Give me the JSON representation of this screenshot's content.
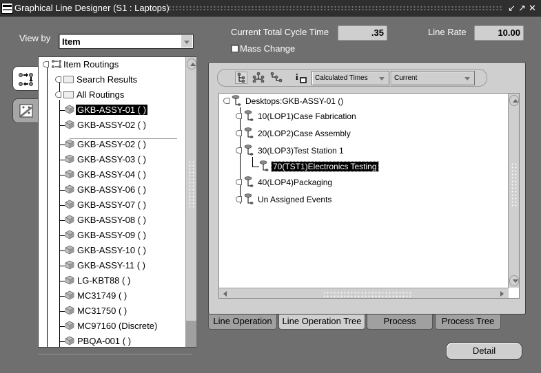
{
  "window": {
    "title": "Graphical Line Designer (S1 : Laptops)",
    "controls": [
      "minimize",
      "maximize",
      "close"
    ]
  },
  "header": {
    "view_by_label": "View by",
    "view_by_value": "Item",
    "cycle_time_label": "Current Total Cycle Time",
    "cycle_time_value": ".35",
    "line_rate_label": "Line Rate",
    "line_rate_value": "10.00",
    "mass_change_label": "Mass Change",
    "mass_change_checked": false
  },
  "left_tabs": [
    {
      "name": "routing-flow",
      "active": true
    },
    {
      "name": "graphical-view",
      "active": false
    }
  ],
  "item_tree": {
    "root": "Item Routings",
    "folders": [
      "Search Results",
      "All Routings"
    ],
    "items": [
      {
        "label": "GKB-ASSY-01 ( )",
        "selected": true
      },
      {
        "label": "GKB-ASSY-02 ( )",
        "selected": false
      },
      {
        "label": "GKB-ASSY-02 ( )",
        "selected": false
      },
      {
        "label": "GKB-ASSY-03 ( )",
        "selected": false
      },
      {
        "label": "GKB-ASSY-04 ( )",
        "selected": false
      },
      {
        "label": "GKB-ASSY-06 ( )",
        "selected": false
      },
      {
        "label": "GKB-ASSY-07 ( )",
        "selected": false
      },
      {
        "label": "GKB-ASSY-08 ( )",
        "selected": false
      },
      {
        "label": "GKB-ASSY-09 ( )",
        "selected": false
      },
      {
        "label": "GKB-ASSY-10 ( )",
        "selected": false
      },
      {
        "label": "GKB-ASSY-11 ( )",
        "selected": false
      },
      {
        "label": "LG-KBT88 ( )",
        "selected": false
      },
      {
        "label": "MC31749 ( )",
        "selected": false
      },
      {
        "label": "MC31750 ( )",
        "selected": false
      },
      {
        "label": "MC97160 (Discrete)",
        "selected": false
      },
      {
        "label": "PBQA-001 ( )",
        "selected": false
      }
    ]
  },
  "toolbar": {
    "times_select": "Calculated Times",
    "version_select": "Current"
  },
  "operation_tree": {
    "root": "Desktops:GKB-ASSY-01 ()",
    "nodes": [
      {
        "label": "10(LOP1)Case Fabrication",
        "level": 1,
        "expander": "plus"
      },
      {
        "label": "20(LOP2)Case Assembly",
        "level": 1,
        "expander": "plus"
      },
      {
        "label": "30(LOP3)Test Station 1",
        "level": 1,
        "expander": "minus"
      },
      {
        "label": "70(TST1)Electronics Testing",
        "level": 2,
        "expander": "none",
        "selected": true
      },
      {
        "label": "40(LOP4)Packaging",
        "level": 1,
        "expander": "plus"
      },
      {
        "label": "Un Assigned Events",
        "level": 1,
        "expander": "plus"
      }
    ]
  },
  "bottom_tabs": [
    {
      "label": "Line Operation",
      "active": false
    },
    {
      "label": "Line Operation Tree",
      "active": true
    },
    {
      "label": "Process",
      "active": false
    },
    {
      "label": "Process Tree",
      "active": false
    }
  ],
  "detail_button": "Detail"
}
